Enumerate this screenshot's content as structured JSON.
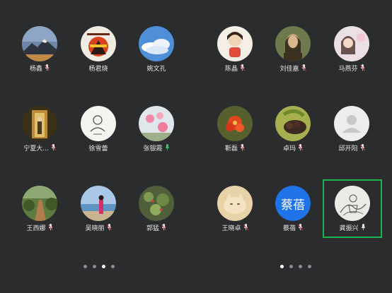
{
  "left_page": {
    "participants": [
      {
        "name": "杨鑫",
        "icon": "mountain-avatar-icon",
        "mic": "muted"
      },
      {
        "name": "杨君烧",
        "icon": "poster-avatar-icon",
        "mic": "none"
      },
      {
        "name": "姚文孔",
        "icon": "sky-avatar-icon",
        "mic": "none"
      },
      {
        "name": "宁夏大...",
        "icon": "doorway-avatar-icon",
        "mic": "muted"
      },
      {
        "name": "徐雪蕾",
        "icon": "sketch-avatar-icon",
        "mic": "none"
      },
      {
        "name": "张银霞",
        "icon": "flowers-avatar-icon",
        "mic": "active"
      },
      {
        "name": "王西娜",
        "icon": "path-avatar-icon",
        "mic": "muted"
      },
      {
        "name": "吴晓丽",
        "icon": "beach-avatar-icon",
        "mic": "muted"
      },
      {
        "name": "郭猛",
        "icon": "plant-avatar-icon",
        "mic": "muted"
      }
    ],
    "pager": {
      "count": 4,
      "active": 2
    }
  },
  "right_page": {
    "participants": [
      {
        "name": "陈晶",
        "icon": "cartoon-girl-avatar-icon",
        "mic": "muted"
      },
      {
        "name": "刘佳嘉",
        "icon": "painting-avatar-icon",
        "mic": "muted"
      },
      {
        "name": "马燕芬",
        "icon": "selfie-avatar-icon",
        "mic": "muted"
      },
      {
        "name": "靳磊",
        "icon": "red-flower-avatar-icon",
        "mic": "muted"
      },
      {
        "name": "卓玛",
        "icon": "fruit-avatar-icon",
        "mic": "muted"
      },
      {
        "name": "邱开阳",
        "icon": "default-user-avatar-icon",
        "mic": "muted"
      },
      {
        "name": "王晓卓",
        "icon": "cat-avatar-icon",
        "mic": "muted"
      },
      {
        "name": "蔡蓓",
        "icon": "text-avatar-icon",
        "avatar_text": "蔡蓓",
        "mic": "muted"
      },
      {
        "name": "龚振兴",
        "icon": "ink-drawing-avatar-icon",
        "mic": "speaking",
        "highlighted": true
      }
    ],
    "pager": {
      "count": 4,
      "active": 0
    }
  },
  "colors": {
    "background": "#2a2c2e",
    "highlight": "#19b34f",
    "mic_active": "#35c76a",
    "mic_muted": "#e04040",
    "text_avatar_bg": "#1e73e8"
  }
}
